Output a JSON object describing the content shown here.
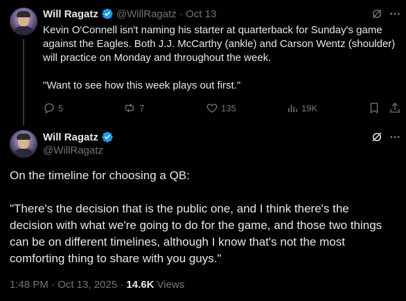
{
  "tweet1": {
    "author_name": "Will Ragatz",
    "meta": "@WillRagatz · Oct 13",
    "lines": [
      "Kevin O'Connell isn't naming his starter at quarterback for Sunday's game",
      "against the Eagles. Both J.J. McCarthy (ankle) and Carson Wentz (shoulder)",
      "will practice on Monday and throughout the week.",
      "",
      "\"Want to see how this week plays out first.\""
    ],
    "replies": "5",
    "reposts": "7",
    "likes": "135",
    "views": "19K"
  },
  "tweet2": {
    "author_name": "Will Ragatz",
    "handle": "@WillRagatz",
    "line1": "On the timeline for choosing a QB:",
    "quote_lines": [
      "\"There's the decision that is the public one, and I think there's the",
      "decision with what we're going to do for the game, and those two things",
      "can be on different timelines, although I know that's not the most",
      "comforting thing to share with you guys.\""
    ],
    "timestamp": "1:48 PM · Oct 13, 2025 · ",
    "view_count": "14.6K",
    "views_label": " Views"
  },
  "icons": {
    "grok": "grok-icon",
    "more": "more-icon",
    "reply": "reply-icon",
    "repost": "repost-icon",
    "like": "like-icon",
    "views": "views-icon",
    "bookmark": "bookmark-icon",
    "share": "share-icon",
    "verified": "verified-badge-icon"
  },
  "colors": {
    "background": "#000000",
    "text": "#e7e9ea",
    "muted": "#71767b",
    "verified": "#1d9bf0"
  }
}
